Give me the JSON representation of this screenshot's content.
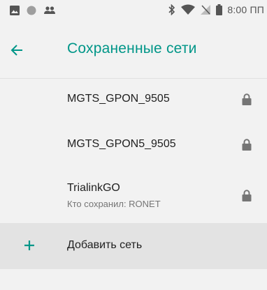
{
  "status_bar": {
    "time": "8:00 ПП",
    "icons": [
      "image-icon",
      "circle-icon",
      "people-icon",
      "bluetooth-icon",
      "wifi-icon",
      "no-sim-icon",
      "battery-icon"
    ]
  },
  "app_bar": {
    "back_icon": "arrow-back-icon",
    "title": "Сохраненные сети",
    "accent_color": "#009688"
  },
  "networks": [
    {
      "ssid": "MGTS_GPON_9505",
      "subtitle": "",
      "icon": "lock-icon"
    },
    {
      "ssid": "MGTS_GPON5_9505",
      "subtitle": "",
      "icon": "lock-icon"
    },
    {
      "ssid": "TrialinkGO",
      "subtitle": "Кто сохранил: RONET",
      "icon": "lock-icon"
    }
  ],
  "add_network": {
    "icon": "plus-icon",
    "label": "Добавить сеть"
  }
}
